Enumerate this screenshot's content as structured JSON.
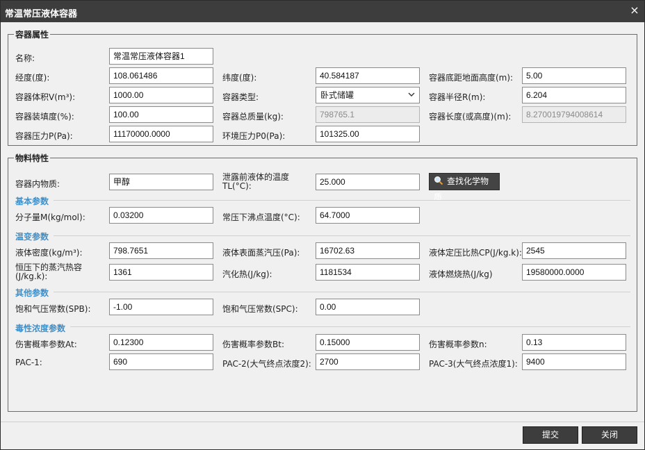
{
  "dialog": {
    "title": "常温常压液体容器",
    "close_symbol": "×"
  },
  "container": {
    "legend": "容器属性",
    "name_label": "名称:",
    "name_value": "常温常压液体容器1",
    "lon_label": "经度(度):",
    "lon_value": "108.061486",
    "lat_label": "纬度(度):",
    "lat_value": "40.584187",
    "base_height_label": "容器底距地面高度(m):",
    "base_height_value": "5.00",
    "volume_label": "容器体积V(m³):",
    "volume_value": "1000.00",
    "type_label": "容器类型:",
    "type_value": "卧式储罐",
    "radius_label": "容器半径R(m):",
    "radius_value": "6.204",
    "fill_label": "容器装填度(%):",
    "fill_value": "100.00",
    "mass_label": "容器总质量(kg):",
    "mass_value": "798765.1",
    "length_label": "容器长度(或高度)(m):",
    "length_value": "8.270019794008614",
    "pressure_label": "容器压力P(Pa):",
    "pressure_value": "11170000.0000",
    "env_pressure_label": "环境压力P0(Pa):",
    "env_pressure_value": "101325.00"
  },
  "material": {
    "legend": "物料特性",
    "substance_label": "容器内物质:",
    "substance_value": "甲醇",
    "temp_label": "泄露前液体的温度TL(°C):",
    "temp_value": "25.000",
    "search_button": "查找化学物质",
    "basic": {
      "title": "基本参数",
      "mw_label": "分子量M(kg/mol):",
      "mw_value": "0.03200",
      "bp_label": "常压下沸点温度(°C):",
      "bp_value": "64.7000"
    },
    "temp_params": {
      "title": "温变参数",
      "density_label": "液体密度(kg/m³):",
      "density_value": "798.7651",
      "vapor_label": "液体表面蒸汽压(Pa):",
      "vapor_value": "16702.63",
      "cp_label": "液体定压比热CP(J/kg.k):",
      "cp_value": "2545",
      "cv_label": "恒压下的蒸汽热容(J/kg.k):",
      "cv_value": "1361",
      "heat_vap_label": "汽化热(J/kg):",
      "heat_vap_value": "1181534",
      "heat_comb_label": "液体燃烧热(J/kg)",
      "heat_comb_value": "19580000.0000"
    },
    "other": {
      "title": "其他参数",
      "spb_label": "饱和气压常数(SPB):",
      "spb_value": "-1.00",
      "spc_label": "饱和气压常数(SPC):",
      "spc_value": "0.00"
    },
    "toxic": {
      "title": "毒性浓度参数",
      "at_label": "伤害概率参数At:",
      "at_value": "0.12300",
      "bt_label": "伤害概率参数Bt:",
      "bt_value": "0.15000",
      "n_label": "伤害概率参数n:",
      "n_value": "0.13",
      "pac1_label": "PAC-1:",
      "pac1_value": "690",
      "pac2_label": "PAC-2(大气终点浓度2):",
      "pac2_value": "2700",
      "pac3_label": "PAC-3(大气终点浓度1):",
      "pac3_value": "9400"
    }
  },
  "footer": {
    "submit_label": "提交",
    "close_label": "关闭"
  }
}
